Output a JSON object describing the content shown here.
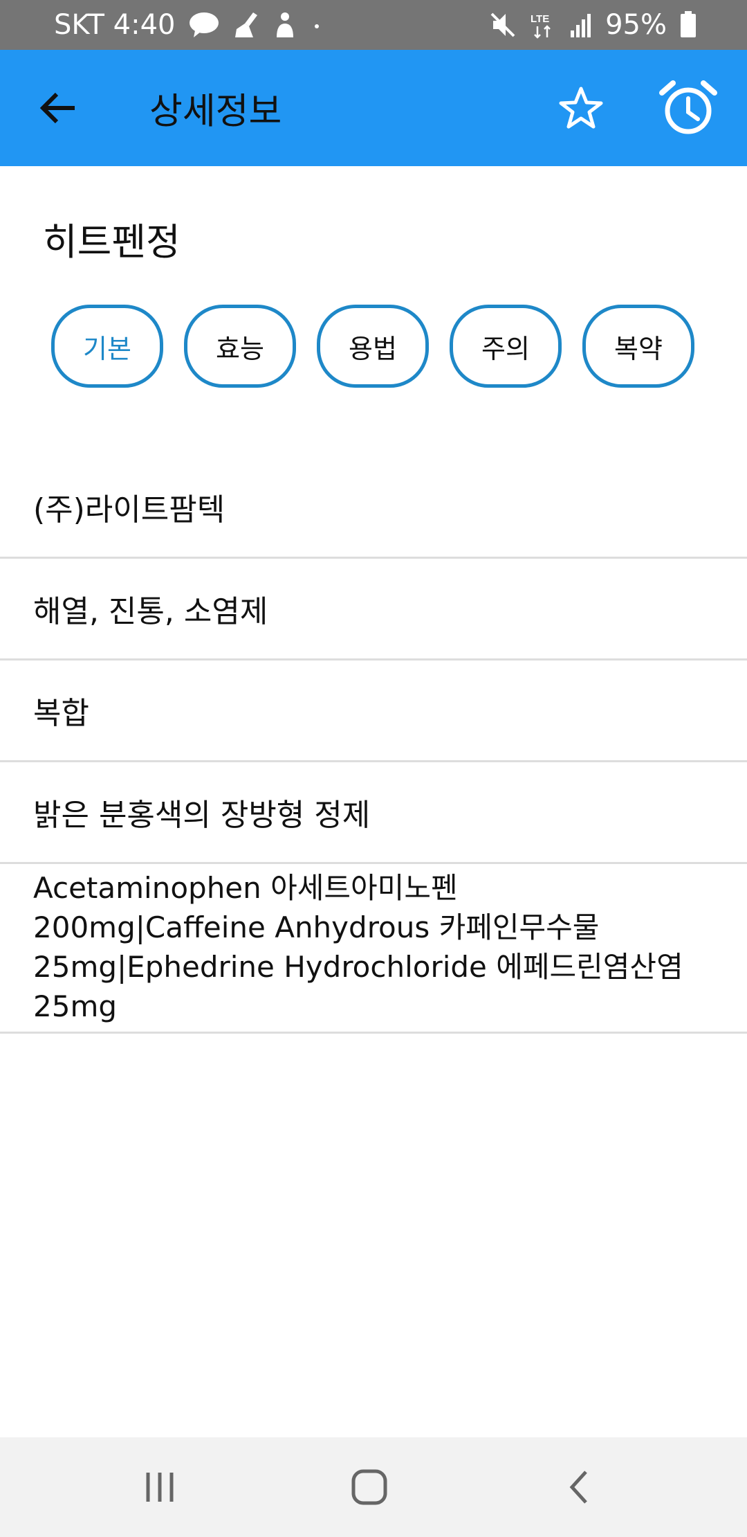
{
  "status_bar": {
    "carrier_time": "SKT 4:40",
    "battery": "95%",
    "icons": [
      "talk-icon",
      "broom-icon",
      "notification-icon",
      "dot-icon",
      "mute-icon",
      "lte-icon",
      "signal-icon",
      "battery-icon"
    ]
  },
  "app_bar": {
    "title": "상세정보",
    "icons": [
      "back-arrow-icon",
      "star-icon",
      "alarm-clock-icon"
    ],
    "color": "#2196f3"
  },
  "drug": {
    "name": "히트펜정"
  },
  "tabs": [
    {
      "label": "기본",
      "active": true
    },
    {
      "label": "효능",
      "active": false
    },
    {
      "label": "용법",
      "active": false
    },
    {
      "label": "주의",
      "active": false
    },
    {
      "label": "복약",
      "active": false
    }
  ],
  "info": {
    "company": "(주)라이트팜텍",
    "category": "해열, 진통, 소염제",
    "type": "복합",
    "appearance": "밝은 분홍색의 장방형 정제",
    "ingredients": [
      "Acetaminophen 아세트아미노펜",
      "200mg|Caffeine Anhydrous 카페인무수물",
      "25mg|Ephedrine Hydrochloride 에페드린염산염",
      "25mg"
    ]
  },
  "nav_bar": {
    "icons": [
      "recent-apps-icon",
      "home-icon",
      "back-icon"
    ]
  },
  "colors": {
    "accent": "#1e88c8",
    "status_bar": "#757575",
    "divider": "#dddddd"
  }
}
